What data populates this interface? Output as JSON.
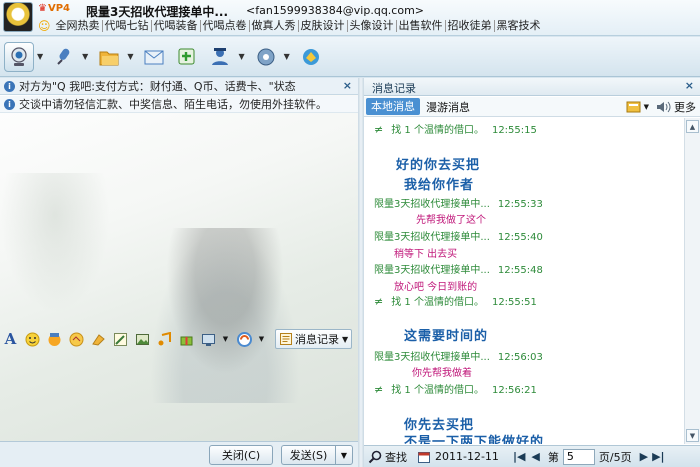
{
  "titlebar": {
    "vip_badge": "VP4",
    "contact_name": "限量3天招收代理接单中...",
    "contact_email": "<fan1599938384@vip.qq.com>",
    "links": [
      "全网热卖",
      "代喝七钻",
      "代喝装备",
      "代喝点卷",
      "做真人秀",
      "皮肤设计",
      "头像设计",
      "出售软件",
      "招收徒弟",
      "黑客技术"
    ]
  },
  "toolbar": {
    "icons": [
      "video-call-icon",
      "voice-call-icon",
      "file-transfer-icon",
      "email-icon",
      "add-app-icon",
      "group-icon",
      "settings-icon",
      "qzone-icon"
    ]
  },
  "chat": {
    "notice1": "对方为\"Q 我吧:支付方式：财付通、Q币、话费卡、\"状态",
    "notice2": "交谈中请勿轻信汇款、中奖信息、陌生电话，勿使用外挂软件。",
    "close_label": "×",
    "history_button": "消息记录",
    "close_button": "关闭(C)",
    "send_button": "发送(S)"
  },
  "history": {
    "title": "消息记录",
    "close_label": "×",
    "tab_local": "本地消息",
    "tab_roaming": "漫游消息",
    "more": "更多",
    "messages": [
      {
        "kind": "sys",
        "text": "找 1 个温情的借口。",
        "time": "12:55:15"
      },
      {
        "kind": "big",
        "text": "好的你去买把"
      },
      {
        "kind": "big",
        "text": "我给你作者"
      },
      {
        "kind": "head",
        "sender": "限量3天招收代理接单中...",
        "time": "12:55:33"
      },
      {
        "kind": "pink",
        "text": "先帮我做了这个"
      },
      {
        "kind": "head",
        "sender": "限量3天招收代理接单中...",
        "time": "12:55:40"
      },
      {
        "kind": "pink",
        "text": "稍等下  出去买"
      },
      {
        "kind": "head",
        "sender": "限量3天招收代理接单中...",
        "time": "12:55:48"
      },
      {
        "kind": "pink",
        "text": "放心吧 今日到账的"
      },
      {
        "kind": "sys",
        "text": "找 1 个温情的借口。",
        "time": "12:55:51"
      },
      {
        "kind": "big",
        "text": "这需要时间的"
      },
      {
        "kind": "head",
        "sender": "限量3天招收代理接单中...",
        "time": "12:56:03"
      },
      {
        "kind": "pink",
        "text": "你先帮我做着"
      },
      {
        "kind": "sys",
        "text": "找 1 个温情的借口。",
        "time": "12:56:21"
      },
      {
        "kind": "big",
        "text": "你先去买把"
      },
      {
        "kind": "big",
        "text": "不是一下两下能做好的"
      }
    ],
    "footer": {
      "search": "查找",
      "date": "2011-12-11",
      "page_label": "第",
      "page_value": "5",
      "page_total": "页/5页"
    }
  }
}
